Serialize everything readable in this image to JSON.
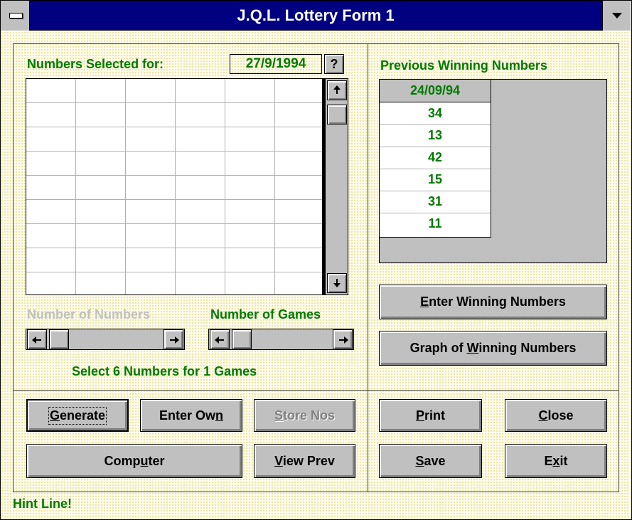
{
  "window": {
    "title": "J.Q.L. Lottery Form 1"
  },
  "selection": {
    "label": "Numbers Selected for:",
    "date": "27/9/1994",
    "help_button": "?"
  },
  "grid": {
    "columns": 6,
    "visible_rows": 9,
    "cells": []
  },
  "sliders": {
    "numbers_label": "Number of Numbers",
    "games_label": "Number of Games",
    "status": "Select 6 Numbers for 1 Games"
  },
  "winning": {
    "label": "Previous Winning Numbers",
    "date": "24/09/94",
    "numbers": [
      "34",
      "13",
      "42",
      "15",
      "31",
      "11"
    ]
  },
  "buttons": {
    "enter_winning": {
      "pre": "",
      "ul": "E",
      "post": "nter Winning Numbers"
    },
    "graph_winning": {
      "pre": "Graph of ",
      "ul": "W",
      "post": "inning Numbers"
    },
    "generate": {
      "pre": "",
      "ul": "G",
      "post": "enerate"
    },
    "enter_own": {
      "pre": "Enter Ow",
      "ul": "n",
      "post": ""
    },
    "store_nos": {
      "pre": "",
      "ul": "S",
      "post": "tore Nos"
    },
    "computer": {
      "pre": "Comp",
      "ul": "u",
      "post": "ter"
    },
    "view_prev": {
      "pre": "",
      "ul": "V",
      "post": "iew Prev"
    },
    "print": {
      "pre": "",
      "ul": "P",
      "post": "rint"
    },
    "close": {
      "pre": "",
      "ul": "C",
      "post": "lose"
    },
    "save": {
      "pre": "",
      "ul": "S",
      "post": "ave"
    },
    "exit": {
      "pre": "E",
      "ul": "x",
      "post": "it"
    }
  },
  "hint": "Hint Line!",
  "colors": {
    "title_bar": "#000080",
    "label_green": "#007a00",
    "face": "#c0c0c0",
    "disabled_text": "#c0c0c0"
  }
}
